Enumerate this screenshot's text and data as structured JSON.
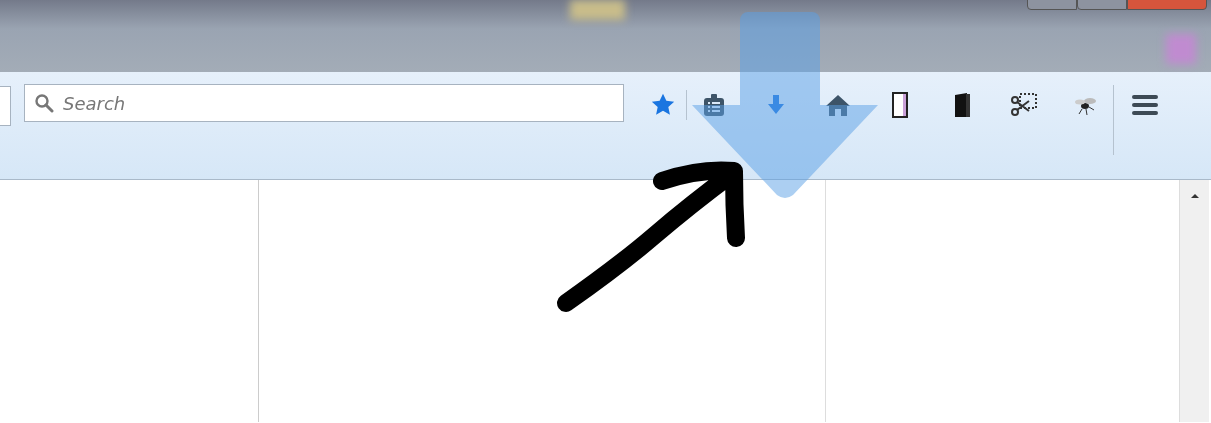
{
  "search": {
    "placeholder": "Search"
  }
}
